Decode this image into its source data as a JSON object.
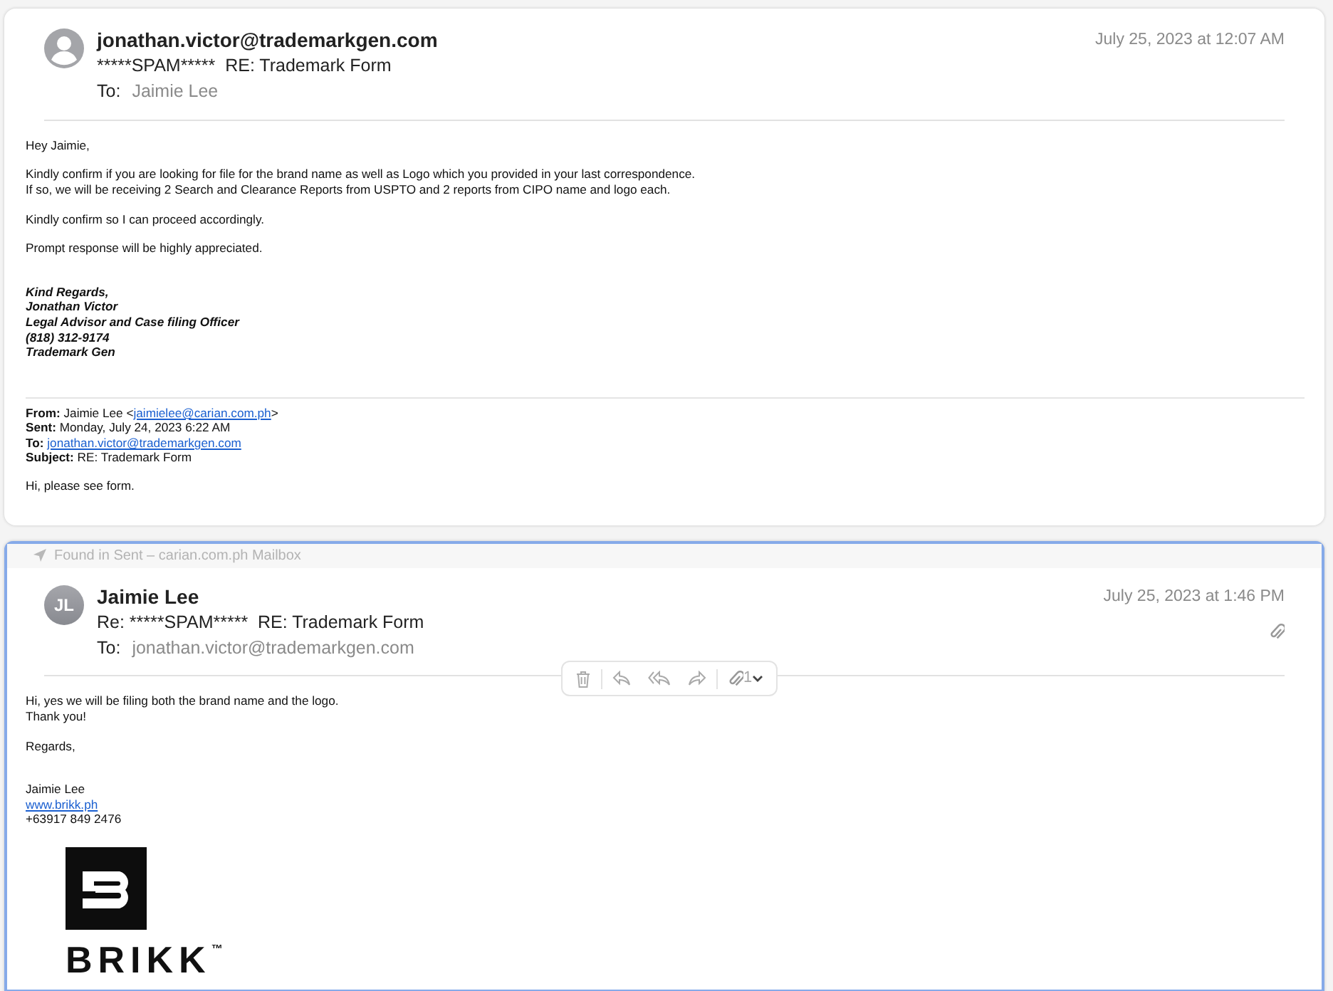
{
  "messages": [
    {
      "selected": false,
      "avatar": {
        "kind": "generic"
      },
      "sender": "jonathan.victor@trademarkgen.com",
      "subject": "*****SPAM*****  RE: Trademark Form",
      "to_label": "To:",
      "to": "Jaimie Lee",
      "date": "July 25, 2023 at 12:07 AM",
      "has_attachment": false,
      "blocks": [
        {
          "kind": "para",
          "lines": [
            "Hey Jaimie,"
          ]
        },
        {
          "kind": "para",
          "lines": [
            "Kindly confirm if you are looking for file for the brand name as well as Logo which you provided in your last correspondence.",
            "If so, we will be receiving 2 Search and Clearance Reports from USPTO and 2 reports from CIPO name and logo each."
          ]
        },
        {
          "kind": "para",
          "lines": [
            "Kindly confirm so I can proceed accordingly."
          ]
        },
        {
          "kind": "para",
          "lines": [
            "Prompt response will be highly appreciated."
          ]
        },
        {
          "kind": "signature",
          "lines": [
            "Kind Regards,",
            "Jonathan Victor",
            "Legal Advisor and Case filing Officer",
            "(818) 312-9174",
            "Trademark Gen"
          ]
        },
        {
          "kind": "header",
          "fields": [
            {
              "label": "From:",
              "before": "Jaimie Lee <",
              "link": "jaimielee@carian.com.ph",
              "after": ">"
            },
            {
              "label": "Sent:",
              "before": "Monday, July 24, 2023 6:22 AM"
            },
            {
              "label": "To:",
              "link": "jonathan.victor@trademarkgen.com"
            },
            {
              "label": "Subject:",
              "before": "RE: Trademark Form"
            }
          ]
        },
        {
          "kind": "para",
          "lines": [
            "Hi, please see form."
          ]
        }
      ]
    },
    {
      "selected": true,
      "found_in": "Found in Sent – carian.com.ph Mailbox",
      "avatar": {
        "kind": "initials",
        "initials": "JL"
      },
      "sender": "Jaimie Lee",
      "subject": "Re: *****SPAM*****  RE: Trademark Form",
      "to_label": "To:",
      "to": "jonathan.victor@trademarkgen.com",
      "date": "July 25, 2023 at 1:46 PM",
      "has_attachment": true,
      "toolbar": [
        {
          "kind": "trash"
        },
        {
          "kind": "reply"
        },
        {
          "kind": "reply-all"
        },
        {
          "kind": "forward"
        },
        {
          "kind": "attachments",
          "label": "1"
        }
      ],
      "blocks": [
        {
          "kind": "para",
          "lines": [
            "Hi, yes we will be filing both the brand name and the logo.",
            "Thank you!"
          ]
        },
        {
          "kind": "para",
          "lines": [
            "Regards,"
          ]
        },
        {
          "kind": "contact",
          "lines": [
            {
              "text": "Jaimie Lee",
              "link": false
            },
            {
              "text": "www.brikk.ph",
              "link": true
            },
            {
              "text": "+63917 849 2476",
              "link": false
            }
          ]
        },
        {
          "kind": "logo",
          "wordmark": "BRIKK",
          "trademark": "™"
        }
      ]
    }
  ]
}
